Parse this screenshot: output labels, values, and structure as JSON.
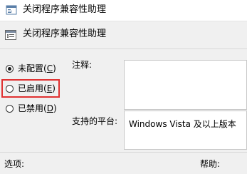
{
  "window": {
    "title": "关闭程序兼容性助理"
  },
  "header": {
    "policy_name": "关闭程序兼容性助理"
  },
  "state": {
    "options": [
      {
        "label": "未配置",
        "accel": "C",
        "checked": true
      },
      {
        "label": "已启用",
        "accel": "E",
        "checked": false
      },
      {
        "label": "已禁用",
        "accel": "D",
        "checked": false
      }
    ]
  },
  "fields": {
    "comment_label": "注释:",
    "supported_label": "支持的平台:",
    "supported_value": "Windows Vista 及以上版本",
    "options_label": "选项:",
    "help_label": "帮助:"
  },
  "colors": {
    "highlight": "#e03131"
  }
}
